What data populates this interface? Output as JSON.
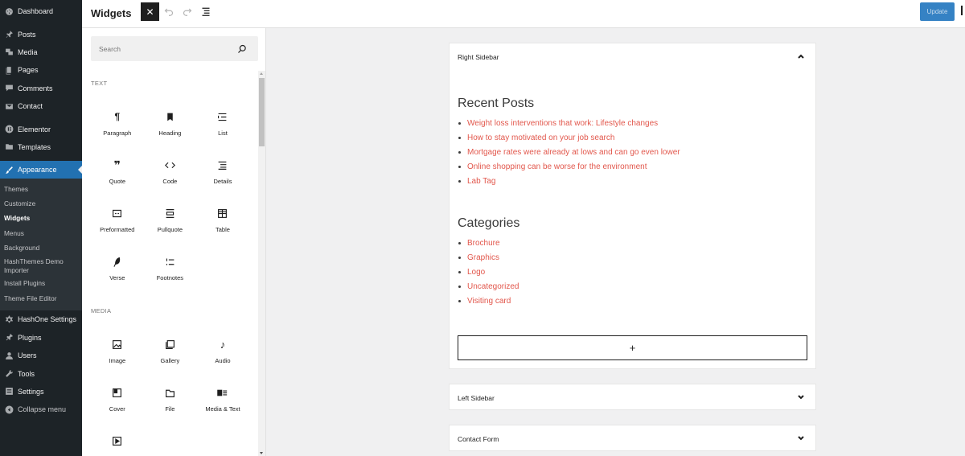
{
  "admin_menu": {
    "items_top": [
      {
        "label": "Dashboard",
        "icon": "dashboard-icon"
      },
      {
        "label": "Posts",
        "icon": "pin-icon"
      },
      {
        "label": "Media",
        "icon": "media-icon"
      },
      {
        "label": "Pages",
        "icon": "pages-icon"
      },
      {
        "label": "Comments",
        "icon": "comment-icon"
      },
      {
        "label": "Contact",
        "icon": "mail-icon"
      },
      {
        "label": "Elementor",
        "icon": "elementor-icon"
      },
      {
        "label": "Templates",
        "icon": "folder-icon"
      },
      {
        "label": "Appearance",
        "icon": "brush-icon"
      }
    ],
    "appearance_submenu": [
      "Themes",
      "Customize",
      "Widgets",
      "Menus",
      "Background",
      "HashThemes Demo Importer",
      "Install Plugins",
      "Theme File Editor"
    ],
    "items_bottom": [
      {
        "label": "HashOne Settings",
        "icon": "gear-icon"
      },
      {
        "label": "Plugins",
        "icon": "plugin-icon"
      },
      {
        "label": "Users",
        "icon": "user-icon"
      },
      {
        "label": "Tools",
        "icon": "wrench-icon"
      },
      {
        "label": "Settings",
        "icon": "settings-icon"
      },
      {
        "label": "Collapse menu",
        "icon": "collapse-icon"
      }
    ],
    "active_submenu": "Widgets",
    "accent_color": "#2271b1"
  },
  "header": {
    "title": "Widgets",
    "close_symbol": "✕",
    "update_label": "Update"
  },
  "inserter": {
    "search_placeholder": "Search",
    "text_category": "TEXT",
    "text_blocks": [
      {
        "label": "Paragraph",
        "icon": "paragraph-icon"
      },
      {
        "label": "Heading",
        "icon": "heading-icon"
      },
      {
        "label": "List",
        "icon": "list-icon"
      },
      {
        "label": "Quote",
        "icon": "quote-icon"
      },
      {
        "label": "Code",
        "icon": "code-icon"
      },
      {
        "label": "Details",
        "icon": "details-icon"
      },
      {
        "label": "Preformatted",
        "icon": "preformatted-icon"
      },
      {
        "label": "Pullquote",
        "icon": "pullquote-icon"
      },
      {
        "label": "Table",
        "icon": "table-icon"
      },
      {
        "label": "Verse",
        "icon": "verse-icon"
      },
      {
        "label": "Footnotes",
        "icon": "footnotes-icon"
      }
    ],
    "media_category": "MEDIA",
    "media_blocks": [
      {
        "label": "Image",
        "icon": "image-icon"
      },
      {
        "label": "Gallery",
        "icon": "gallery-icon"
      },
      {
        "label": "Audio",
        "icon": "audio-icon"
      },
      {
        "label": "Cover",
        "icon": "cover-icon"
      },
      {
        "label": "File",
        "icon": "file-icon"
      },
      {
        "label": "Media & Text",
        "icon": "media-text-icon"
      },
      {
        "label": "",
        "icon": "video-icon"
      }
    ]
  },
  "widget_areas": {
    "right_sidebar": {
      "name": "Right Sidebar",
      "recent_posts_title": "Recent Posts",
      "recent_posts": [
        "Weight loss interventions that work: Lifestyle changes",
        "How to stay motivated on your job search",
        "Mortgage rates were already at lows and can go even lower",
        "Online shopping can be worse for the environment",
        "Lab Tag"
      ],
      "categories_title": "Categories",
      "categories": [
        "Brochure",
        "Graphics",
        "Logo",
        "Uncategorized",
        "Visiting card"
      ],
      "add_symbol": "+",
      "link_color": "#e2574c"
    },
    "left_sidebar": {
      "name": "Left Sidebar"
    },
    "contact_form": {
      "name": "Contact Form"
    }
  }
}
